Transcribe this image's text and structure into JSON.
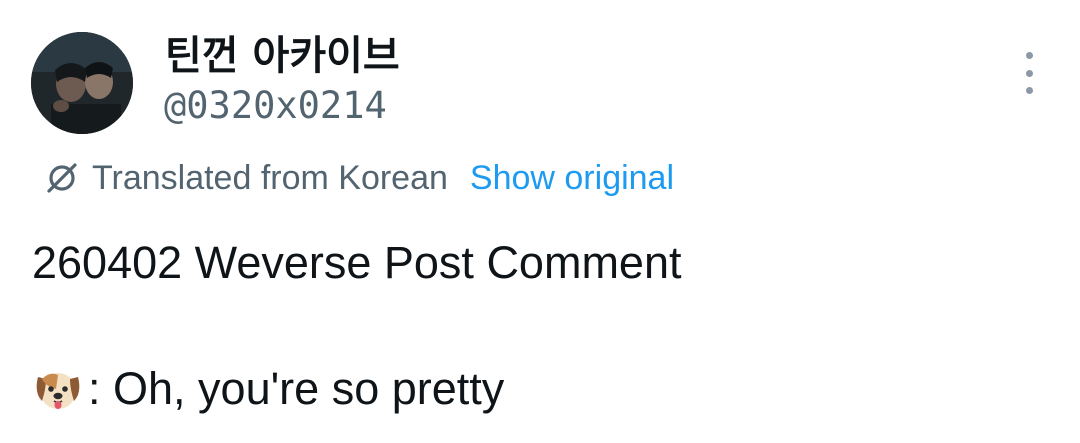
{
  "author": {
    "display_name": "틴껀 아카이브",
    "handle": "@0320x0214",
    "avatar_icon": "profile-photo-avatar"
  },
  "menu": {
    "icon": "more-vertical-icon"
  },
  "translation": {
    "icon": "translate-icon",
    "label": "Translated from Korean",
    "action_label": "Show original",
    "action_color": "#1d9bf0"
  },
  "post": {
    "line1": "260402 Weverse Post Comment",
    "emoji_icon": "dog-face-emoji",
    "line2_text": ": Oh, you're so pretty"
  },
  "colors": {
    "text_primary": "#0f1419",
    "text_secondary": "#536471",
    "link": "#1d9bf0"
  }
}
